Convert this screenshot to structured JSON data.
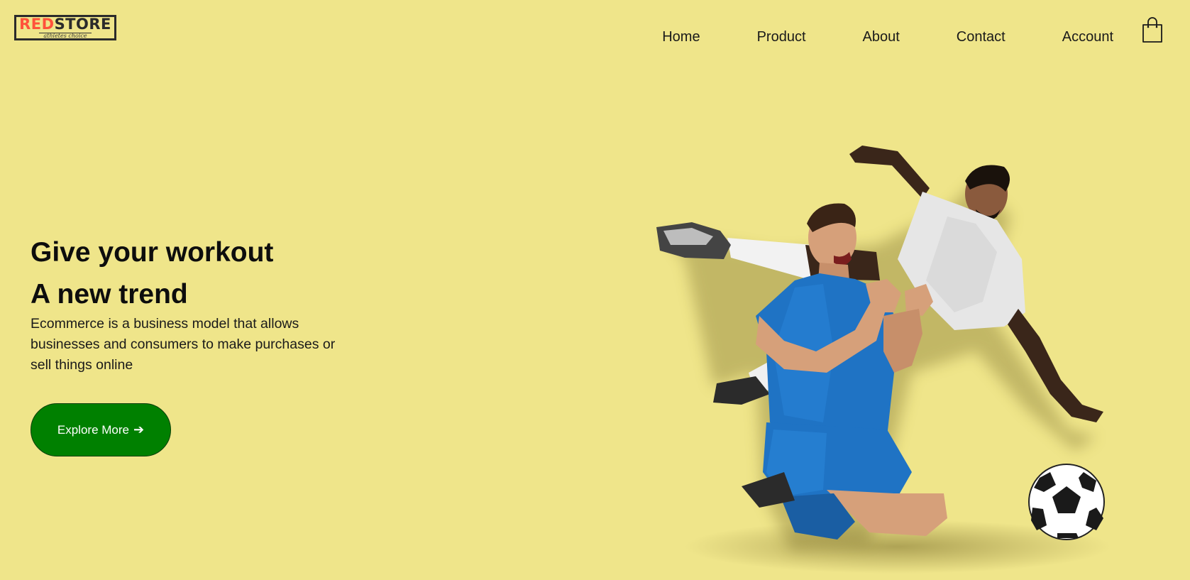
{
  "brand": {
    "logo_red": "RED",
    "logo_dark": "STORE",
    "tagline": "athletes choice"
  },
  "nav": {
    "items": [
      {
        "label": "Home"
      },
      {
        "label": "Product"
      },
      {
        "label": "About"
      },
      {
        "label": "Contact"
      },
      {
        "label": "Account"
      }
    ],
    "cart_icon": "shopping-bag-icon"
  },
  "hero": {
    "title_line1": "Give your workout",
    "title_line2": "A new trend",
    "description": "Ecommerce is a business model that allows businesses and consumers to make purchases or sell things online",
    "button_label": "Explore More",
    "button_arrow": "➔",
    "image_subject": "two-soccer-players-with-ball"
  },
  "colors": {
    "background": "#efe58a",
    "logo_accent": "#ff523b",
    "button": "#008000",
    "jersey_blue": "#1f73c4",
    "jersey_white": "#e9e9e9"
  }
}
